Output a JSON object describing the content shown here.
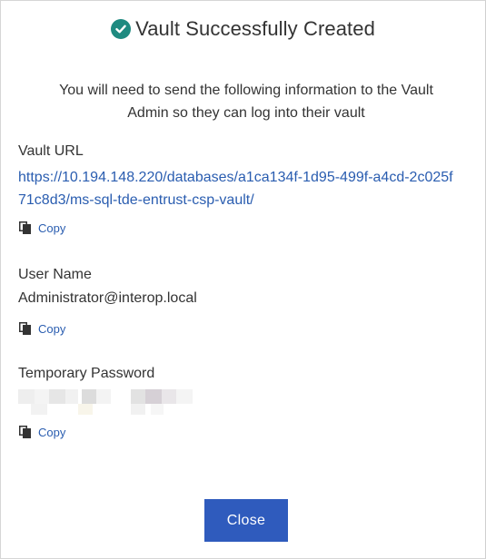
{
  "dialog": {
    "title": "Vault Successfully Created",
    "intro_line1": "You will need to send the following information to the Vault",
    "intro_line2": "Admin so they can log into their vault",
    "vault_url": {
      "label": "Vault URL",
      "value": "https://10.194.148.220/databases/a1ca134f-1d95-499f-a4cd-2c025f71c8d3/ms-sql-tde-entrust-csp-vault/",
      "copy_label": "Copy"
    },
    "user_name": {
      "label": "User Name",
      "value": "Administrator@interop.local",
      "copy_label": "Copy"
    },
    "temp_password": {
      "label": "Temporary Password",
      "copy_label": "Copy"
    },
    "close_label": "Close"
  },
  "colors": {
    "accent": "#2f5bbd",
    "link": "#2a5db0",
    "success": "#1f8a80",
    "text": "#333333"
  },
  "icons": [
    "check-circle-icon",
    "copy-icon"
  ]
}
